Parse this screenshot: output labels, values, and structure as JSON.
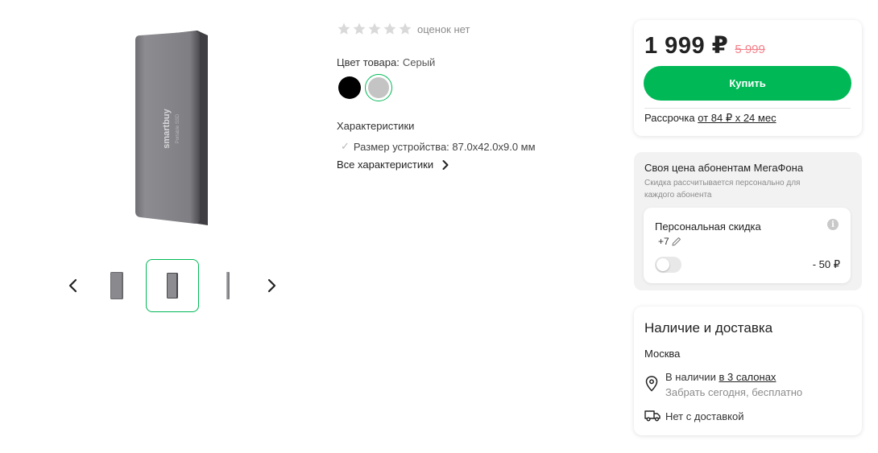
{
  "rating": {
    "stars_filled": 0,
    "stars_total": 5,
    "text": "оценок нет"
  },
  "product": {
    "color_label": "Цвет товара:",
    "color_value": "Серый",
    "colors": [
      "#000000",
      "#c4c4c4"
    ],
    "selected_color": "Серый",
    "characteristics_title": "Характеристики",
    "characteristics": [
      "Размер устройства: 87.0x42.0x9.0 мм"
    ],
    "all_characteristics": "Все характеристики"
  },
  "gallery": {
    "device_brand": "smartbuy",
    "selected_thumb": 2
  },
  "price": {
    "current": "1 999 ₽",
    "old": "5 999",
    "buy_label": "Купить",
    "installment_label": "Рассрочка",
    "installment_link": "от 84 ₽ x 24 мес"
  },
  "promo": {
    "title": "Своя цена абонентам МегаФона",
    "subtitle": "Скидка рассчитывается персонально для каждого абонента",
    "personal_discount": "Персональная скидка",
    "phone": "+7",
    "discount_value": "- 50 ₽",
    "toggle_on": false
  },
  "delivery": {
    "title": "Наличие и доставка",
    "city": "Москва",
    "availability_prefix": "В наличии",
    "availability_link": "в 3 салонах",
    "pickup": "Забрать сегодня, бесплатно",
    "no_delivery": "Нет с доставкой"
  },
  "colors": {
    "accent": "#00b956",
    "old_price": "#f4808a"
  }
}
